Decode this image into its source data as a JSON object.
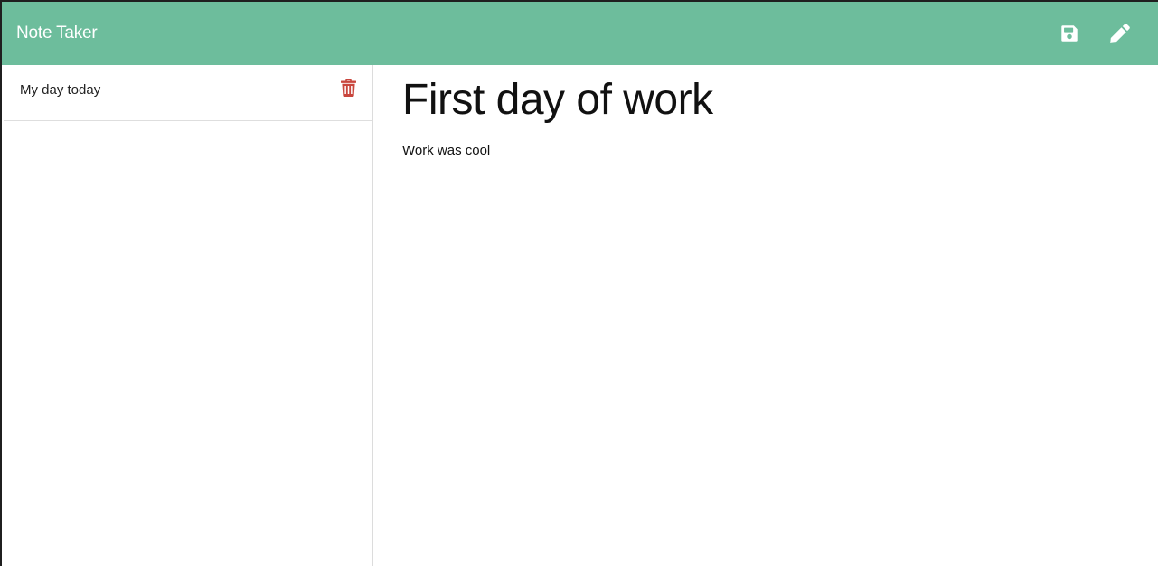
{
  "navbar": {
    "brand": "Note Taker",
    "color": "#6dbd9c",
    "icons": [
      "save-icon",
      "pen-icon"
    ]
  },
  "notes_list": {
    "items": [
      {
        "label": "My day today",
        "icon": "trash-icon",
        "icon_color": "#c9463d"
      }
    ]
  },
  "editor": {
    "title": "First day of work",
    "text": "Work was cool"
  }
}
